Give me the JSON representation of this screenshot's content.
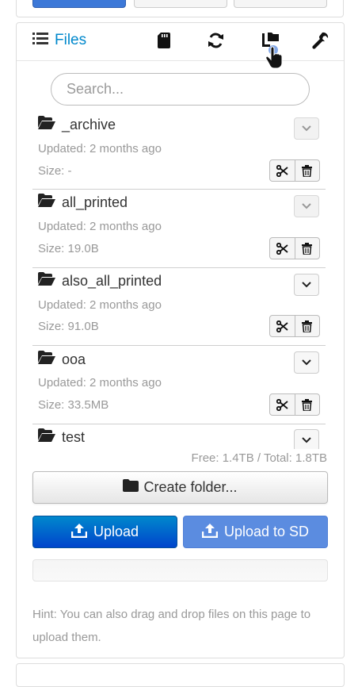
{
  "header": {
    "files_tab_label": "Files",
    "icons": [
      "sd-card-icon",
      "refresh-icon",
      "folder-tree-icon",
      "wrench-icon"
    ]
  },
  "search": {
    "placeholder": "Search...",
    "value": ""
  },
  "files": [
    {
      "name": "_archive",
      "updated": "Updated: 2 months ago",
      "size": "Size: -"
    },
    {
      "name": "all_printed",
      "updated": "Updated: 2 months ago",
      "size": "Size: 19.0B"
    },
    {
      "name": "also_all_printed",
      "updated": "Updated: 2 months ago",
      "size": "Size: 91.0B"
    },
    {
      "name": "ooa",
      "updated": "Updated: 2 months ago",
      "size": "Size: 33.5MB"
    },
    {
      "name": "test"
    }
  ],
  "storage_info": "Free: 1.4TB / Total: 1.8TB",
  "buttons": {
    "create_folder": "Create folder...",
    "upload": "Upload",
    "upload_sd": "Upload to SD"
  },
  "upload_progress": 0,
  "hint": "Hint: You can also drag and drop files on this page to upload them.",
  "colors": {
    "accent": "#0088cc",
    "upload_primary": "#0044cc",
    "upload_sd": "#5b8ce0",
    "muted_text": "#999999"
  }
}
